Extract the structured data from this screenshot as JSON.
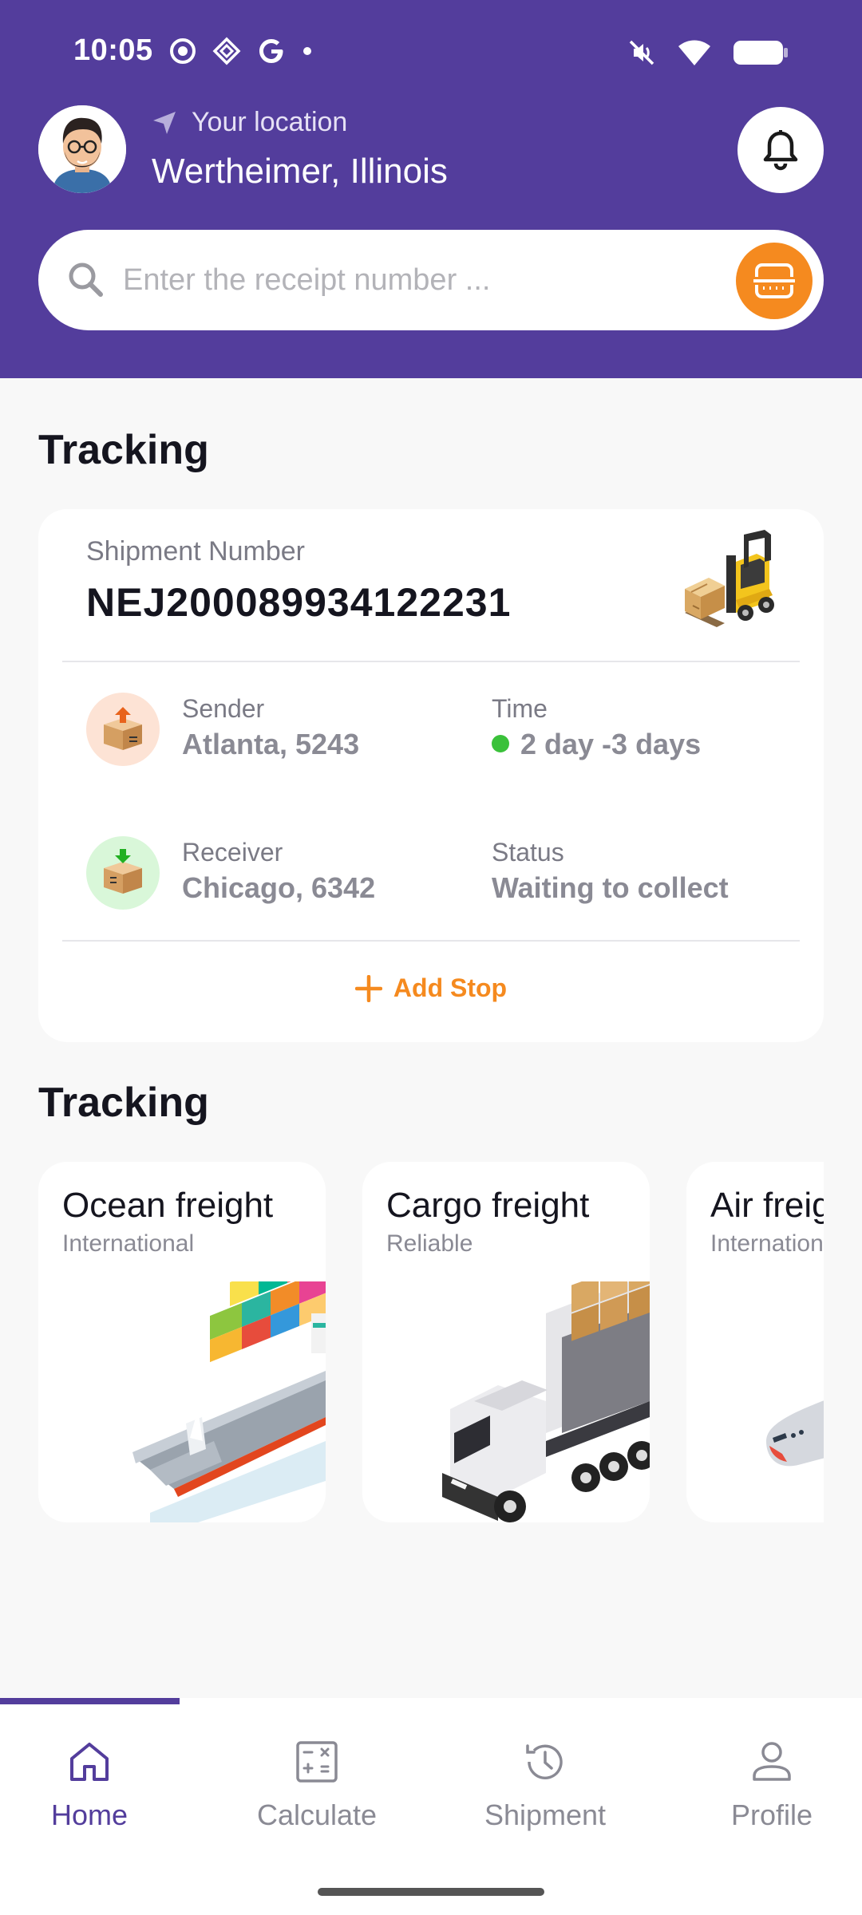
{
  "status_bar": {
    "time": "10:05"
  },
  "header": {
    "location_label": "Your location",
    "location_city": "Wertheimer, Illinois",
    "search_placeholder": "Enter the receipt number ..."
  },
  "tracking_section": {
    "title": "Tracking",
    "card": {
      "shipment_label": "Shipment Number",
      "shipment_number": "NEJ200089934122231",
      "sender_label": "Sender",
      "sender_value": "Atlanta, 5243",
      "time_label": "Time",
      "time_value": "2 day -3 days",
      "receiver_label": "Receiver",
      "receiver_value": "Chicago, 6342",
      "status_label": "Status",
      "status_value": "Waiting to collect",
      "add_stop_label": "Add Stop"
    }
  },
  "freight_section": {
    "title": "Tracking",
    "items": [
      {
        "title": "Ocean freight",
        "subtitle": "International",
        "icon": "ship-illustration"
      },
      {
        "title": "Cargo freight",
        "subtitle": "Reliable",
        "icon": "truck-illustration"
      },
      {
        "title": "Air freight",
        "subtitle": "International",
        "icon": "plane-illustration"
      }
    ]
  },
  "bottom_nav": {
    "items": [
      {
        "label": "Home",
        "icon": "home-icon",
        "active": true
      },
      {
        "label": "Calculate",
        "icon": "calculator-icon",
        "active": false
      },
      {
        "label": "Shipment",
        "icon": "history-icon",
        "active": false
      },
      {
        "label": "Profile",
        "icon": "person-icon",
        "active": false
      }
    ]
  },
  "colors": {
    "brand_purple": "#533d9c",
    "accent_orange": "#f58a1f",
    "status_green": "#3ac13a"
  }
}
